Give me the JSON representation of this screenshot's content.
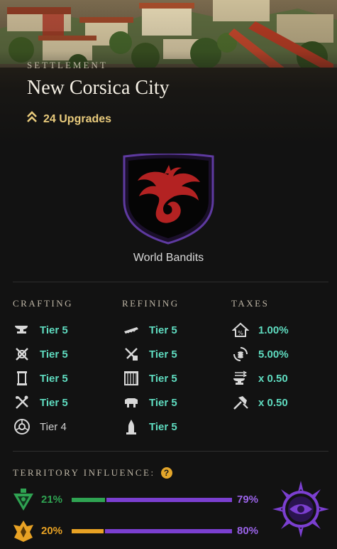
{
  "header": {
    "kicker": "SETTLEMENT",
    "title": "New Corsica City",
    "upgrades": "24 Upgrades"
  },
  "company": {
    "name": "World Bandits"
  },
  "crafting": {
    "label": "CRAFTING",
    "items": [
      {
        "icon": "anvil-icon",
        "value": "Tier 5"
      },
      {
        "icon": "crossed-tools-icon",
        "value": "Tier 5"
      },
      {
        "icon": "scroll-icon",
        "value": "Tier 5"
      },
      {
        "icon": "cooking-icon",
        "value": "Tier 5"
      },
      {
        "icon": "arcane-circle-icon",
        "value": "Tier 4"
      }
    ]
  },
  "refining": {
    "label": "REFINING",
    "items": [
      {
        "icon": "saw-icon",
        "value": "Tier 5"
      },
      {
        "icon": "smelter-icon",
        "value": "Tier 5"
      },
      {
        "icon": "loom-icon",
        "value": "Tier 5"
      },
      {
        "icon": "tannery-icon",
        "value": "Tier 5"
      },
      {
        "icon": "stonecutter-icon",
        "value": "Tier 5"
      }
    ]
  },
  "taxes": {
    "label": "TAXES",
    "items": [
      {
        "icon": "property-tax-icon",
        "value": "1.00%"
      },
      {
        "icon": "trading-tax-icon",
        "value": "5.00%"
      },
      {
        "icon": "crafting-fee-icon",
        "value": "x 0.50"
      },
      {
        "icon": "refining-fee-icon",
        "value": "x 0.50"
      }
    ]
  },
  "influence": {
    "label": "TERRITORY INFLUENCE:",
    "help": "?",
    "rows": [
      {
        "faction": "syndicate-icon",
        "left_pct": "21%",
        "right_pct": "79%",
        "left_fraction": 0.21,
        "color": "#2fa352"
      },
      {
        "faction": "marauders-icon",
        "left_pct": "20%",
        "right_pct": "80%",
        "left_fraction": 0.2,
        "color": "#e8a224"
      }
    ],
    "owner_icon": "covenant-eye-icon",
    "owner_color": "#7b3fd0"
  }
}
